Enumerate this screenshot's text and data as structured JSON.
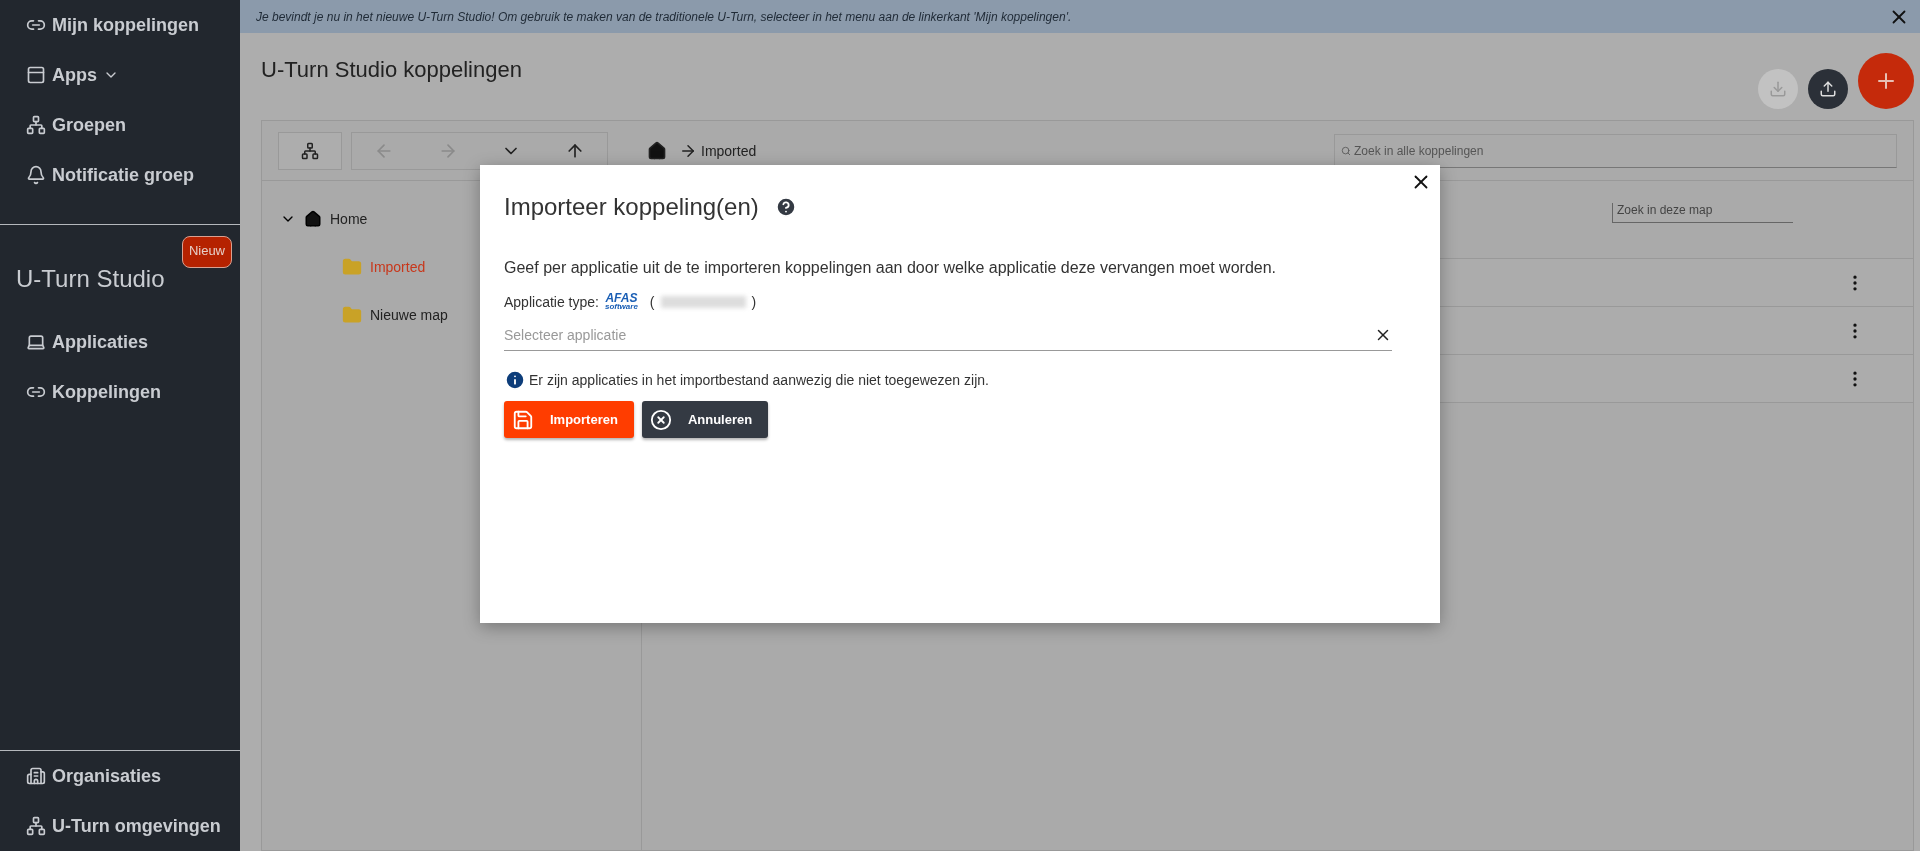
{
  "sidebar": {
    "top_items": [
      {
        "label": "Mijn koppelingen",
        "expandable": false
      },
      {
        "label": "Apps",
        "expandable": true
      },
      {
        "label": "Groepen",
        "expandable": false
      },
      {
        "label": "Notificatie groep",
        "expandable": false
      }
    ],
    "section": {
      "title": "U-Turn Studio",
      "badge": "Nieuw"
    },
    "section_items": [
      {
        "label": "Applicaties"
      },
      {
        "label": "Koppelingen"
      }
    ],
    "bottom_items": [
      {
        "label": "Organisaties"
      },
      {
        "label": "U-Turn omgevingen"
      }
    ]
  },
  "banner": {
    "text": "Je bevindt je nu in het nieuwe U-Turn Studio! Om gebruik te maken van de traditionele U-Turn, selecteer in het menu aan de linkerkant 'Mijn koppelingen'."
  },
  "page": {
    "title": "U-Turn Studio koppelingen"
  },
  "toolbar": {
    "breadcrumb": "Imported",
    "search": {
      "placeholder": "Zoek in alle koppelingen"
    }
  },
  "tree": [
    {
      "label": "Home",
      "expanded": true,
      "children": [
        {
          "label": "Imported",
          "selected": true
        },
        {
          "label": "Nieuwe map",
          "selected": false
        }
      ]
    }
  ],
  "folder_search": {
    "placeholder": "Zoek in deze map"
  },
  "rows": [
    {},
    {},
    {}
  ],
  "dialog": {
    "title": "Importeer koppeling(en)",
    "description": "Geef per applicatie uit de te importeren koppelingen aan door welke applicatie deze vervangen moet worden.",
    "type_label": "Applicatie type:",
    "logo_text": "AFAS",
    "logo_subtext": "software",
    "open_paren": "(",
    "close_paren": ")",
    "select": {
      "placeholder": "Selecteer applicatie"
    },
    "info": "Er zijn applicaties in het importbestand aanwezig die niet toegewezen zijn.",
    "buttons": [
      {
        "kind": "primary",
        "label": "Importeren"
      },
      {
        "kind": "secondary",
        "label": "Annuleren"
      }
    ]
  }
}
